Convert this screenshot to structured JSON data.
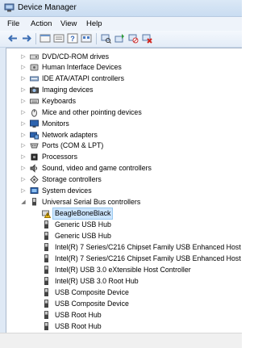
{
  "window": {
    "title": "Device Manager"
  },
  "menubar": {
    "items": [
      "File",
      "Action",
      "View",
      "Help"
    ]
  },
  "toolbar": {
    "buttons": [
      {
        "icon": "back-arrow-icon"
      },
      {
        "icon": "forward-arrow-icon"
      },
      {
        "icon": "properties-icon"
      },
      {
        "icon": "device-list-icon"
      },
      {
        "icon": "help-icon"
      },
      {
        "icon": "device-view-icon"
      },
      {
        "icon": "scan-hardware-icon"
      },
      {
        "icon": "update-driver-icon"
      },
      {
        "icon": "disable-device-icon"
      },
      {
        "icon": "uninstall-device-icon"
      }
    ]
  },
  "tree": {
    "categories": [
      {
        "label": "DVD/CD-ROM drives",
        "icon": "dvd-drive-icon"
      },
      {
        "label": "Human Interface Devices",
        "icon": "hid-icon"
      },
      {
        "label": "IDE ATA/ATAPI controllers",
        "icon": "ide-controller-icon"
      },
      {
        "label": "Imaging devices",
        "icon": "camera-icon"
      },
      {
        "label": "Keyboards",
        "icon": "keyboard-icon"
      },
      {
        "label": "Mice and other pointing devices",
        "icon": "mouse-icon"
      },
      {
        "label": "Monitors",
        "icon": "monitor-icon"
      },
      {
        "label": "Network adapters",
        "icon": "network-adapter-icon"
      },
      {
        "label": "Ports (COM & LPT)",
        "icon": "port-icon"
      },
      {
        "label": "Processors",
        "icon": "processor-icon"
      },
      {
        "label": "Sound, video and game controllers",
        "icon": "sound-icon"
      },
      {
        "label": "Storage controllers",
        "icon": "storage-icon"
      },
      {
        "label": "System devices",
        "icon": "system-device-icon"
      },
      {
        "label": "Universal Serial Bus controllers",
        "icon": "usb-controller-icon",
        "expanded": true
      }
    ],
    "usb_children": [
      {
        "label": "BeagleBoneBlack",
        "icon": "warning-device-icon",
        "selected": true
      },
      {
        "label": "Generic USB Hub"
      },
      {
        "label": "Generic USB Hub"
      },
      {
        "label": "Intel(R) 7 Series/C216 Chipset Family USB Enhanced Host C"
      },
      {
        "label": "Intel(R) 7 Series/C216 Chipset Family USB Enhanced Host C"
      },
      {
        "label": "Intel(R) USB 3.0 eXtensible Host Controller"
      },
      {
        "label": "Intel(R) USB 3.0 Root Hub"
      },
      {
        "label": "USB Composite Device"
      },
      {
        "label": "USB Composite Device"
      },
      {
        "label": "USB Root Hub"
      },
      {
        "label": "USB Root Hub"
      }
    ]
  }
}
